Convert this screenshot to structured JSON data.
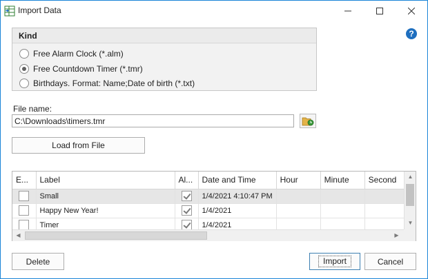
{
  "window": {
    "title": "Import Data",
    "icons": {
      "app": "import-grid-icon",
      "minimize": "minimize-icon",
      "maximize": "maximize-icon",
      "close": "close-icon",
      "help": "help-icon"
    }
  },
  "kind": {
    "header": "Kind",
    "options": [
      {
        "label": "Free Alarm Clock (*.alm)",
        "checked": false
      },
      {
        "label": "Free Countdown Timer (*.tmr)",
        "checked": true
      },
      {
        "label": "Birthdays. Format: Name;Date of birth (*.txt)",
        "checked": false
      }
    ]
  },
  "help": {
    "glyph": "?"
  },
  "file": {
    "label": "File name:",
    "value": "C:\\Downloads\\timers.tmr",
    "browse_icon": "folder-open-icon"
  },
  "load_button": "Load from File",
  "grid": {
    "columns": [
      "E...",
      "Label",
      "Al...",
      "Date and Time",
      "Hour",
      "Minute",
      "Second"
    ],
    "rows": [
      {
        "enabled": false,
        "label": "Small",
        "alarm": true,
        "datetime": "1/4/2021 4:10:47 PM",
        "hour": "",
        "minute": "",
        "second": "",
        "selected": true
      },
      {
        "enabled": false,
        "label": "Happy New Year!",
        "alarm": true,
        "datetime": "1/4/2021",
        "hour": "",
        "minute": "",
        "second": "",
        "selected": false
      },
      {
        "enabled": false,
        "label": "Timer",
        "alarm": true,
        "datetime": "1/4/2021",
        "hour": "",
        "minute": "",
        "second": "",
        "selected": false
      }
    ]
  },
  "buttons": {
    "delete": "Delete",
    "import": "Import",
    "cancel": "Cancel"
  }
}
